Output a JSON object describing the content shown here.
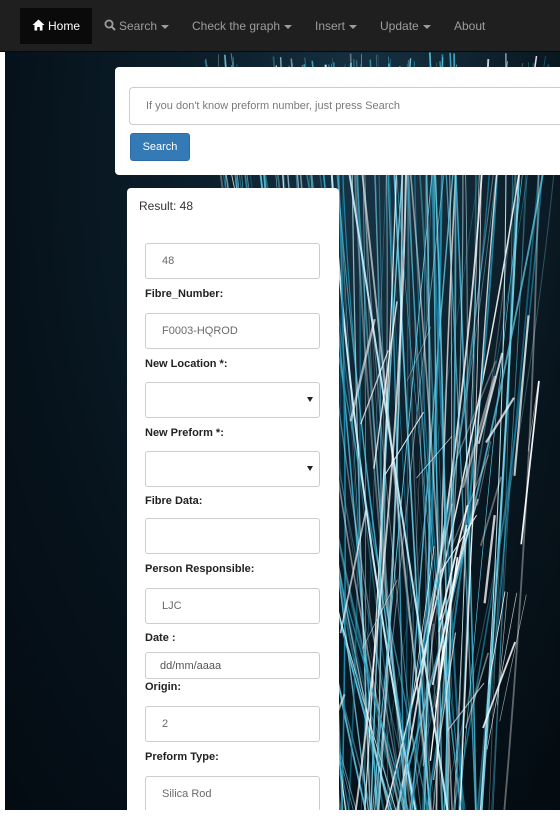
{
  "navbar": {
    "home": {
      "label": "Home",
      "icon": "home-icon"
    },
    "search": {
      "label": "Search",
      "icon": "search-icon"
    },
    "check_graph": {
      "label": "Check the graph"
    },
    "insert": {
      "label": "Insert"
    },
    "update": {
      "label": "Update"
    },
    "about": {
      "label": "About"
    }
  },
  "search_panel": {
    "placeholder": "If you don't know preform number, just press Search",
    "value": "",
    "button_label": "Search"
  },
  "result": {
    "label": "Result: 48",
    "id_value": "48",
    "fields": {
      "fibre_number": {
        "label": "Fibre_Number:",
        "value": "F0003-HQROD"
      },
      "new_location": {
        "label": "New Location *:",
        "value": ""
      },
      "new_preform": {
        "label": "New Preform *:",
        "value": ""
      },
      "fibre_data": {
        "label": "Fibre Data:",
        "value": ""
      },
      "person_responsible": {
        "label": "Person Responsible:",
        "value": "LJC"
      },
      "date": {
        "label": "Date :",
        "value": "dd/mm/aaaa"
      },
      "origin": {
        "label": "Origin:",
        "value": "2"
      },
      "preform_type": {
        "label": "Preform Type:",
        "value": "Silica Rod"
      }
    }
  },
  "colors": {
    "navbar_bg": "#1f1f1f",
    "primary_button": "#337ab7",
    "background": "#06121b",
    "fiber_light": "#7fd8ee"
  }
}
